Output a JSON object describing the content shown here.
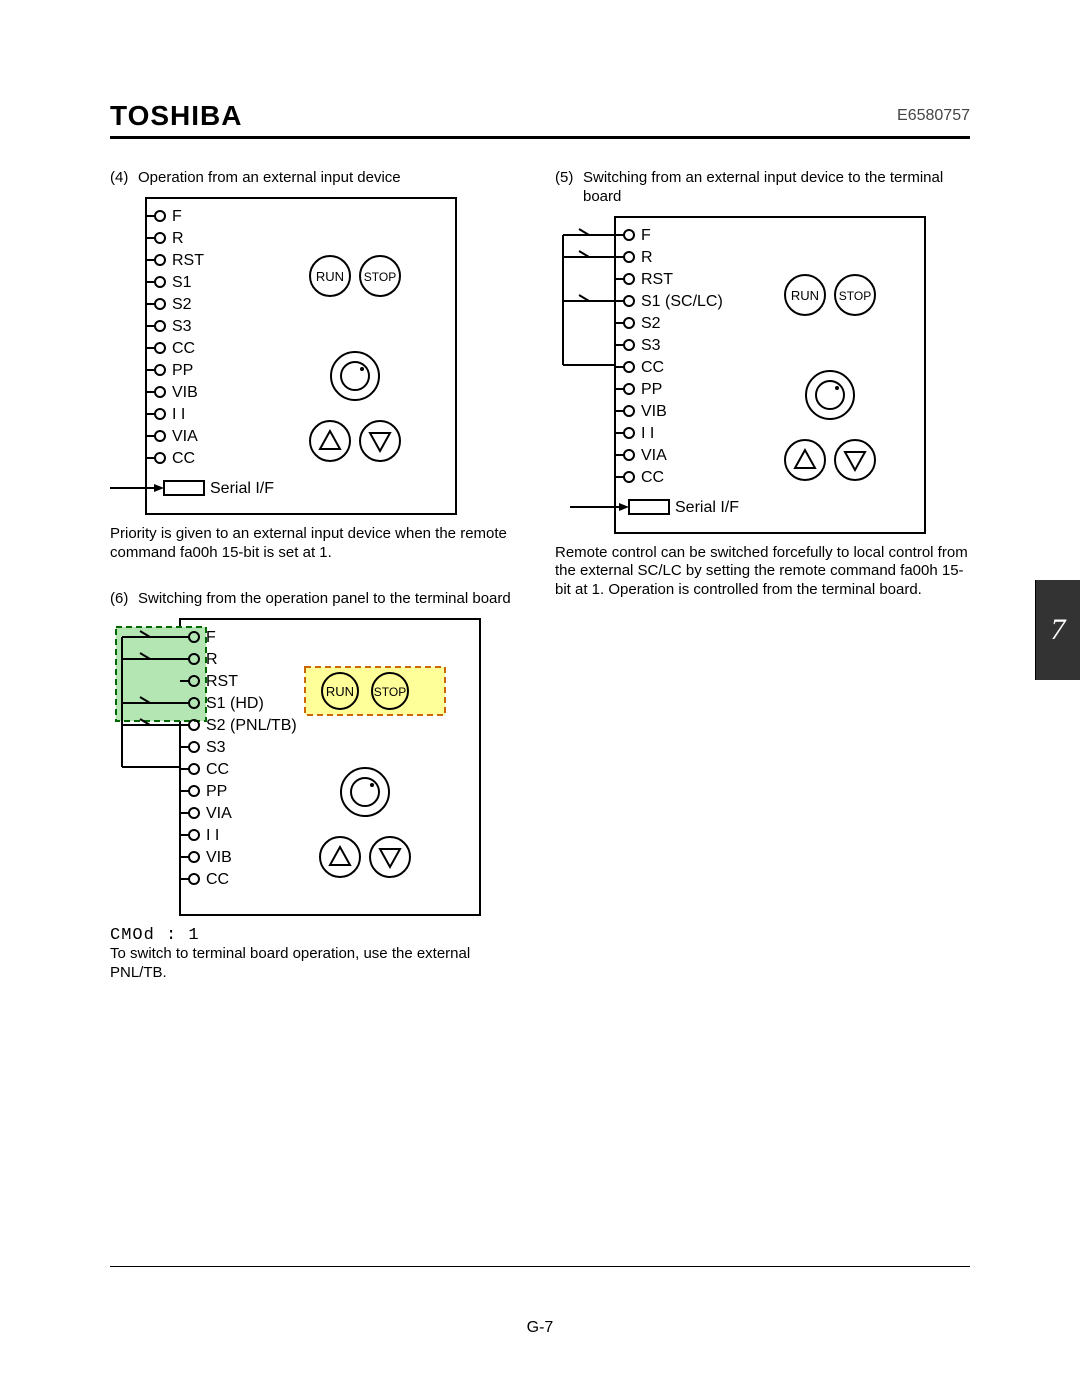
{
  "header": {
    "brand": "TOSHIBA",
    "docnum": "E6580757"
  },
  "section_number": "7",
  "page_footer": "G-7",
  "items": [
    {
      "num": "(4)",
      "title": "Operation from an external input device",
      "caption": "Priority is given to an external input device when the remote command fa00h 15-bit is set at 1.",
      "terminals": [
        "F",
        "R",
        "RST",
        "S1",
        "S2",
        "S3",
        "CC",
        "PP",
        "VIB",
        "I I",
        "VIA",
        "CC"
      ],
      "serial_label": "Serial I/F",
      "run_label": "RUN",
      "stop_label": "STOP"
    },
    {
      "num": "(5)",
      "title": "Switching from an external input device to the terminal board",
      "caption": "Remote control can be switched forcefully to local control from the external SC/LC by setting the remote command fa00h 15-bit at 1. Operation is controlled from the terminal board.",
      "terminals": [
        "F",
        "R",
        "RST",
        "S1 (SC/LC)",
        "S2",
        "S3",
        "CC",
        "PP",
        "VIB",
        "I I",
        "VIA",
        "CC"
      ],
      "serial_label": "Serial I/F",
      "run_label": "RUN",
      "stop_label": "STOP"
    },
    {
      "num": "(6)",
      "title": "Switching from the operation panel to the terminal board",
      "caption_prefix_code": "CMOd : 1",
      "caption": "To switch to terminal board operation, use the external PNL/TB.",
      "terminals": [
        "F",
        "R",
        "RST",
        "S1 (HD)",
        "S2 (PNL/TB)",
        "S3",
        "CC",
        "PP",
        "VIA",
        "I I",
        "VIB",
        "CC"
      ],
      "run_label": "RUN",
      "stop_label": "STOP"
    }
  ]
}
